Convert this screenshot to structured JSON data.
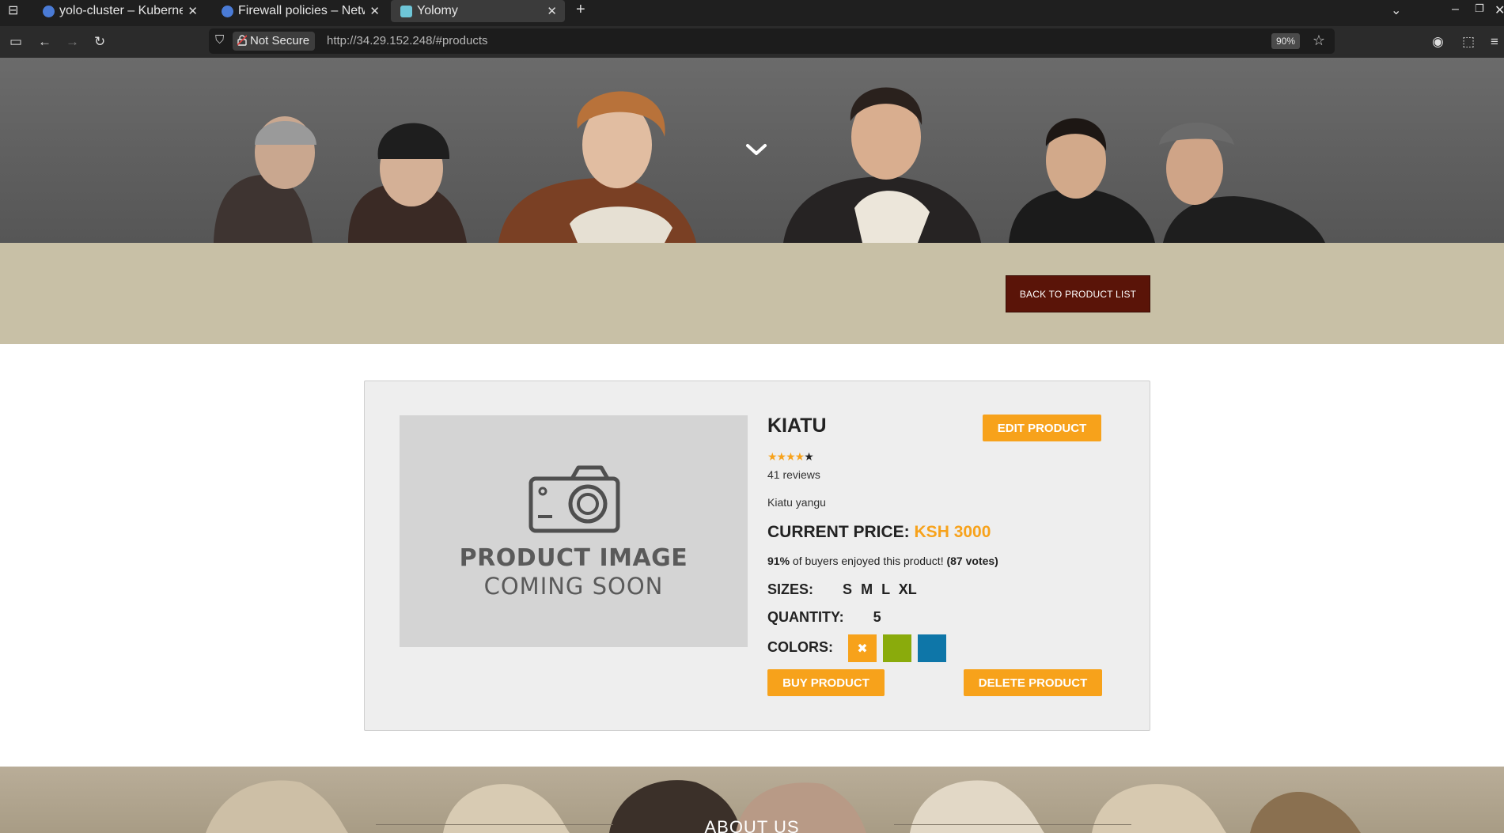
{
  "browser": {
    "tabs": [
      {
        "title": "yolo-cluster – Kubernetes",
        "favicon_color": "#4a7bd6",
        "active": false
      },
      {
        "title": "Firewall policies – Network",
        "favicon_color": "#4a7bd6",
        "active": false
      },
      {
        "title": "Yolomy",
        "favicon_color": "#6ec6d8",
        "active": true
      }
    ],
    "new_tab": "+",
    "not_secure_label": "Not Secure",
    "url": "http://34.29.152.248/#products",
    "zoom": "90%"
  },
  "band": {
    "back_button": "BACK TO PRODUCT LIST"
  },
  "product": {
    "image_line1": "PRODUCT IMAGE",
    "image_line2": "COMING SOON",
    "name": "KIATU",
    "edit_button": "EDIT PRODUCT",
    "stars": "★★★★",
    "stars_empty": "★",
    "rating": 4,
    "rating_max": 5,
    "reviews": "41 reviews",
    "description": "Kiatu yangu",
    "price_label": "CURRENT PRICE:",
    "price_value": "KSH 3000",
    "votes_percent": "91%",
    "votes_text": " of buyers enjoyed this product! ",
    "votes_count": "(87 votes)",
    "sizes_label": "SIZES:",
    "sizes": [
      "S",
      "M",
      "L",
      "XL"
    ],
    "quantity_label": "QUANTITY:",
    "quantity": "5",
    "colors_label": "COLORS:",
    "colors": [
      {
        "hex": "#f7a21b",
        "selected_mark": "✖"
      },
      {
        "hex": "#8aab0c",
        "selected_mark": ""
      },
      {
        "hex": "#0e76a8",
        "selected_mark": ""
      }
    ],
    "buy_button": "BUY PRODUCT",
    "delete_button": "DELETE PRODUCT"
  },
  "about": {
    "title": "ABOUT US"
  },
  "colors": {
    "accent": "#f7a21b",
    "dark_red": "#5a1408",
    "band": "#c8c0a6"
  }
}
